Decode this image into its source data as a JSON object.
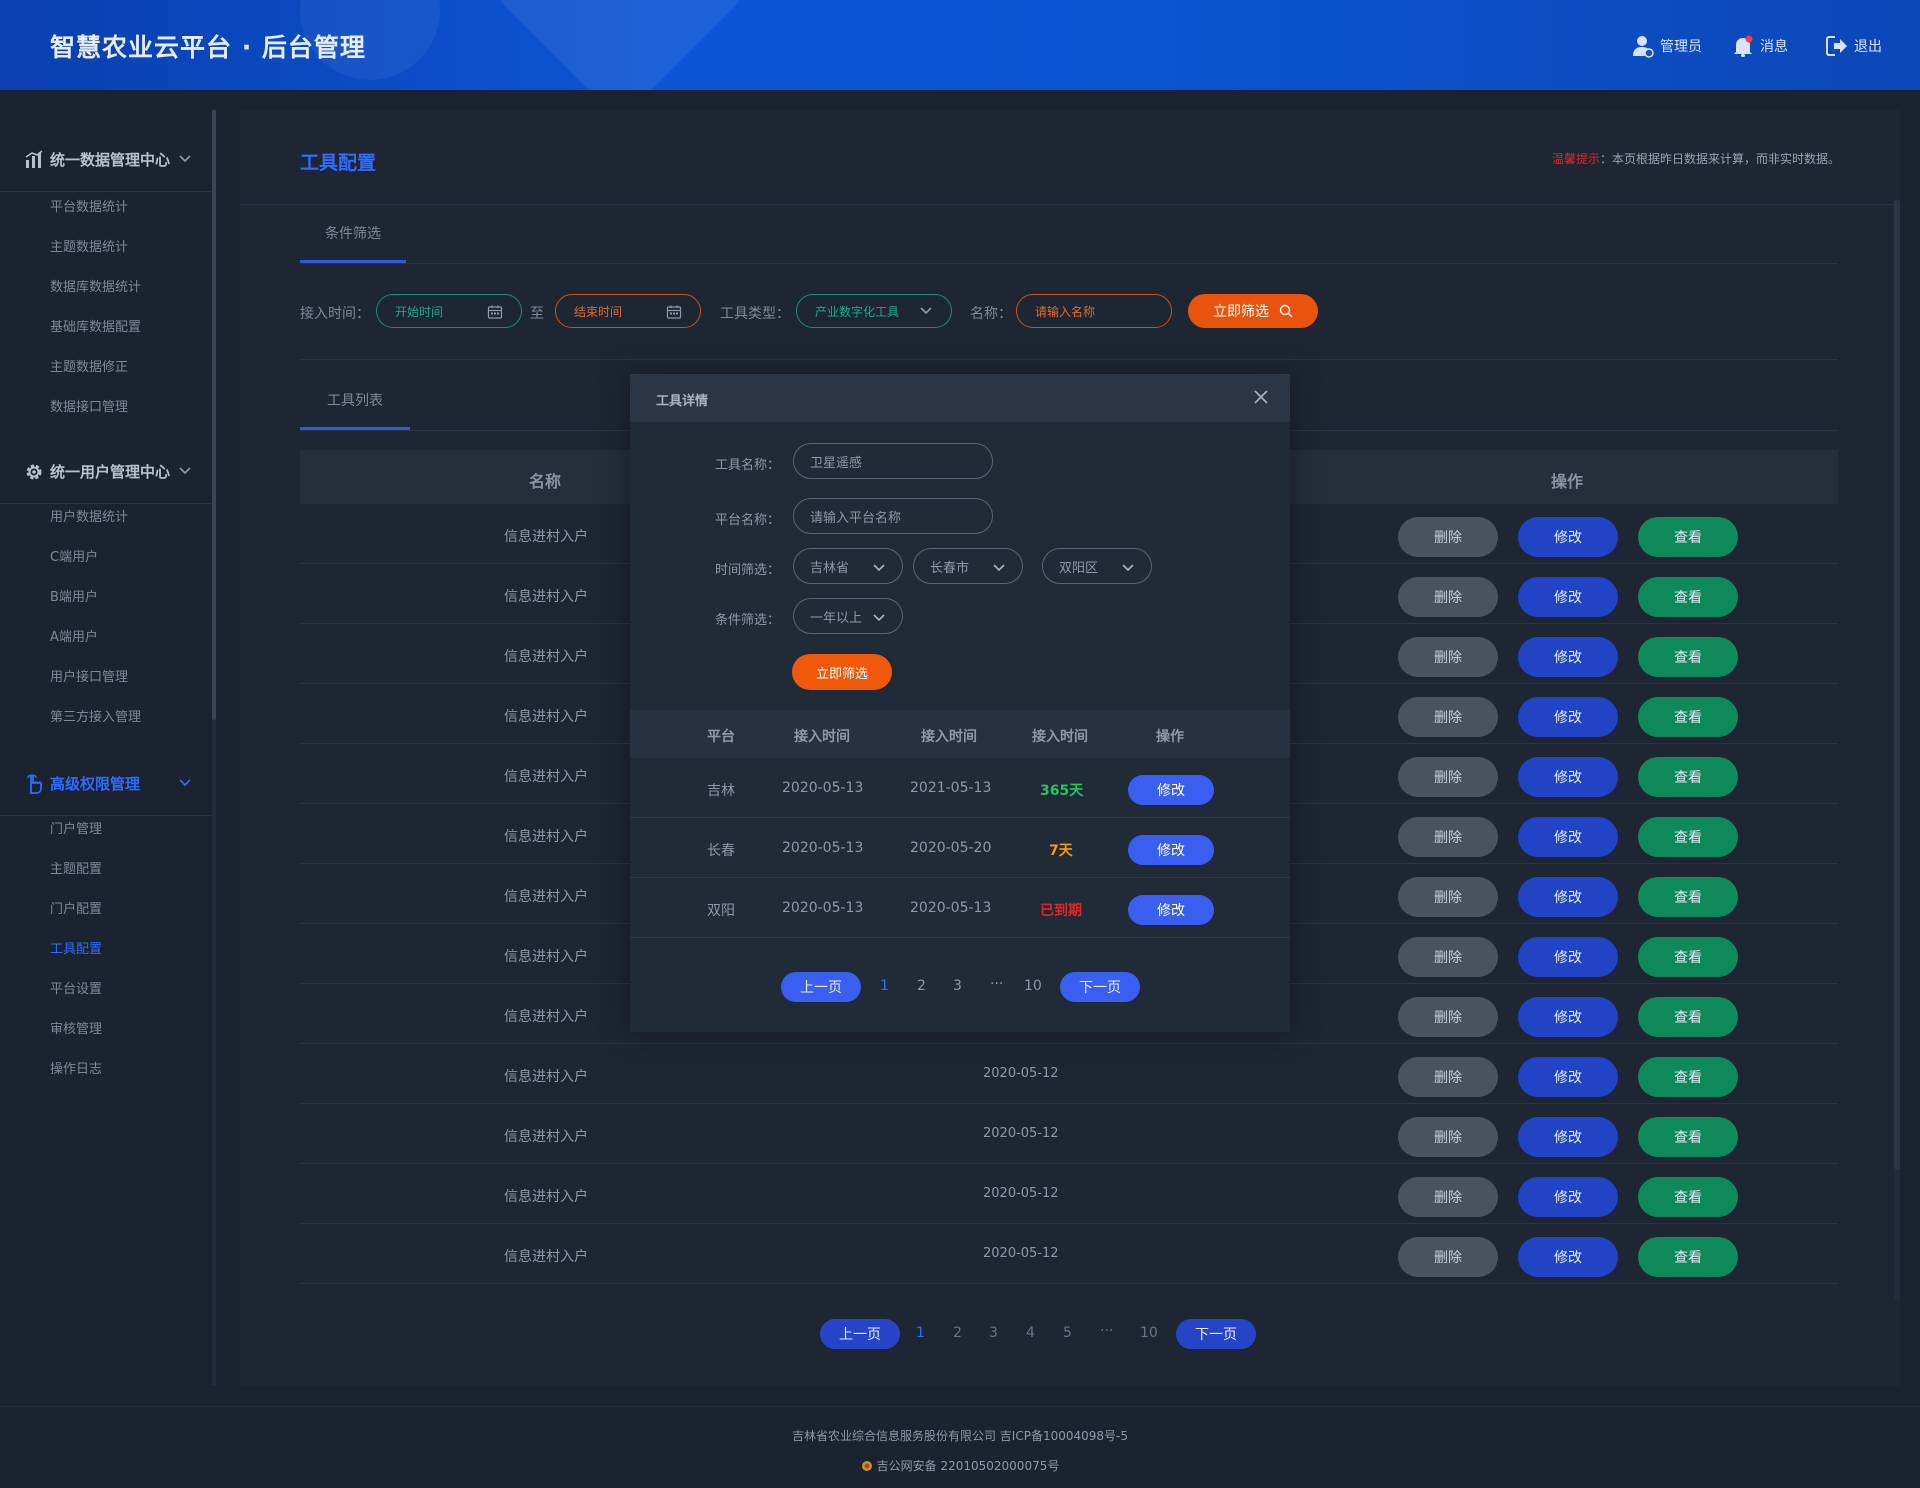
{
  "header": {
    "title": "智慧农业云平台 · 后台管理",
    "admin_label": "管理员",
    "messages_label": "消息",
    "logout_label": "退出"
  },
  "sidebar": {
    "sections": [
      {
        "title": "统一数据管理中心",
        "icon": "bar-chart-icon",
        "items": [
          "平台数据统计",
          "主题数据统计",
          "数据库数据统计",
          "基础库数据配置",
          "主题数据修正",
          "数据接口管理"
        ]
      },
      {
        "title": "统一用户管理中心",
        "icon": "gear-icon",
        "items": [
          "用户数据统计",
          "C端用户",
          "B端用户",
          "A端用户",
          "用户接口管理",
          "第三方接入管理"
        ]
      },
      {
        "title": "高级权限管理",
        "icon": "hand-pointer-icon",
        "items": [
          "门户管理",
          "主题配置",
          "门户配置",
          "工具配置",
          "平台设置",
          "审核管理",
          "操作日志"
        ]
      }
    ],
    "active_item": "工具配置"
  },
  "main": {
    "page_title": "工具配置",
    "tip_warn": "温馨提示",
    "tip_text": "：本页根据昨日数据来计算，而非实时数据。",
    "filter_tab": "条件筛选",
    "filter": {
      "time_label": "接入时间：",
      "start_placeholder": "开始时间",
      "to": "至",
      "end_placeholder": "结束时间",
      "type_label": "工具类型：",
      "type_value": "产业数字化工具",
      "name_label": "名称：",
      "name_placeholder": "请输入名称",
      "submit": "立即筛选"
    },
    "list_tab": "工具列表",
    "table": {
      "col_name": "名称",
      "col_action": "操作",
      "rows": [
        {
          "name": "信息进村入户",
          "date": ""
        },
        {
          "name": "信息进村入户",
          "date": ""
        },
        {
          "name": "信息进村入户",
          "date": ""
        },
        {
          "name": "信息进村入户",
          "date": ""
        },
        {
          "name": "信息进村入户",
          "date": ""
        },
        {
          "name": "信息进村入户",
          "date": ""
        },
        {
          "name": "信息进村入户",
          "date": ""
        },
        {
          "name": "信息进村入户",
          "date": ""
        },
        {
          "name": "信息进村入户",
          "date": ""
        },
        {
          "name": "信息进村入户",
          "date": "2020-05-12"
        },
        {
          "name": "信息进村入户",
          "date": "2020-05-12"
        },
        {
          "name": "信息进村入户",
          "date": "2020-05-12"
        },
        {
          "name": "信息进村入户",
          "date": "2020-05-12"
        }
      ],
      "delete": "删除",
      "edit": "修改",
      "view": "查看"
    },
    "pagination": {
      "prev": "上一页",
      "next": "下一页",
      "pages": [
        "1",
        "2",
        "3",
        "4",
        "5",
        "···",
        "10"
      ],
      "current": "1"
    }
  },
  "modal": {
    "title": "工具详情",
    "tool_name_label": "工具名称：",
    "tool_name_value": "卫星遥感",
    "platform_label": "平台名称：",
    "platform_placeholder": "请输入平台名称",
    "time_filter_label": "时间筛选：",
    "province": "吉林省",
    "city": "长春市",
    "district": "双阳区",
    "condition_label": "条件筛选：",
    "condition_value": "一年以上",
    "submit": "立即筛选",
    "table": {
      "headers": [
        "平台",
        "接入时间",
        "接入时间",
        "接入时间",
        "操作"
      ],
      "rows": [
        {
          "platform": "吉林",
          "start": "2020-05-13",
          "end": "2021-05-13",
          "status": "365天",
          "status_color": "#22c55e"
        },
        {
          "platform": "长春",
          "start": "2020-05-13",
          "end": "2020-05-20",
          "status": "7天",
          "status_color": "#f59e0b"
        },
        {
          "platform": "双阳",
          "start": "2020-05-13",
          "end": "2020-05-13",
          "status": "已到期",
          "status_color": "#e0262a"
        }
      ],
      "edit": "修改"
    },
    "pagination": {
      "prev": "上一页",
      "next": "下一页",
      "pages": [
        "1",
        "2",
        "3",
        "···",
        "10"
      ],
      "current": "1"
    }
  },
  "footer": {
    "line1": "吉林省农业综合信息服务股份有限公司    吉ICP备10004098号-5",
    "line2": "吉公网安备 22010502000075号"
  }
}
